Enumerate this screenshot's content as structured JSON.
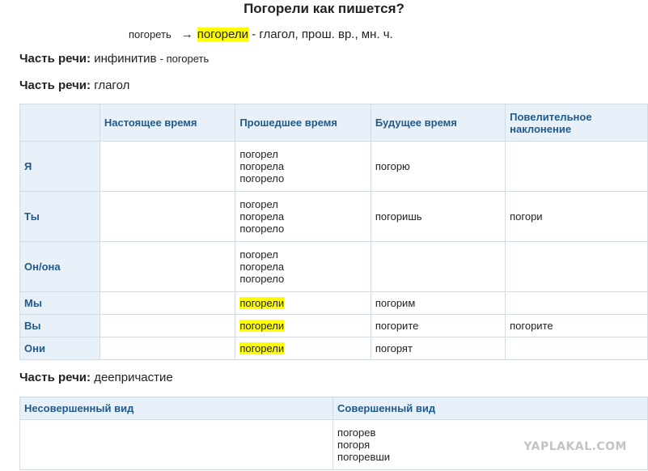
{
  "title": "Погорели как пишется?",
  "word_line": {
    "infinitive": "погореть",
    "arrow": "→",
    "form": "погорели",
    "description": "- глагол, прош. вр., мн. ч."
  },
  "pos1": {
    "label": "Часть речи:",
    "value": "инфинитив",
    "extra": "- погореть"
  },
  "pos2": {
    "label": "Часть речи:",
    "value": "глагол"
  },
  "conjugation": {
    "headers": [
      "",
      "Настоящее время",
      "Прошедшее время",
      "Будущее время",
      "Повелительное наклонение"
    ],
    "rows": [
      {
        "person": "Я",
        "present": "",
        "past": [
          "погорел",
          "погорела",
          "погорело"
        ],
        "future": "погорю",
        "imperative": ""
      },
      {
        "person": "Ты",
        "present": "",
        "past": [
          "погорел",
          "погорела",
          "погорело"
        ],
        "future": "погоришь",
        "imperative": "погори"
      },
      {
        "person": "Он/она",
        "present": "",
        "past": [
          "погорел",
          "погорела",
          "погорело"
        ],
        "future": "",
        "imperative": ""
      },
      {
        "person": "Мы",
        "present": "",
        "past": [
          "погорели"
        ],
        "future": "погорим",
        "imperative": ""
      },
      {
        "person": "Вы",
        "present": "",
        "past": [
          "погорели"
        ],
        "future": "погорите",
        "imperative": "погорите"
      },
      {
        "person": "Они",
        "present": "",
        "past": [
          "погорели"
        ],
        "future": "погорят",
        "imperative": ""
      }
    ]
  },
  "pos3": {
    "label": "Часть речи:",
    "value": "деепричастие"
  },
  "gerund": {
    "headers": [
      "Несовершенный вид",
      "Совершенный вид"
    ],
    "imperfective": "",
    "perfective": [
      "погорев",
      "погоря",
      "погоревши"
    ]
  },
  "watermark": "YAPLAKAL.COM",
  "colors": {
    "highlight": "#ffff00",
    "header_text": "#1f5a8c",
    "header_bg": "#e8f1f9"
  }
}
